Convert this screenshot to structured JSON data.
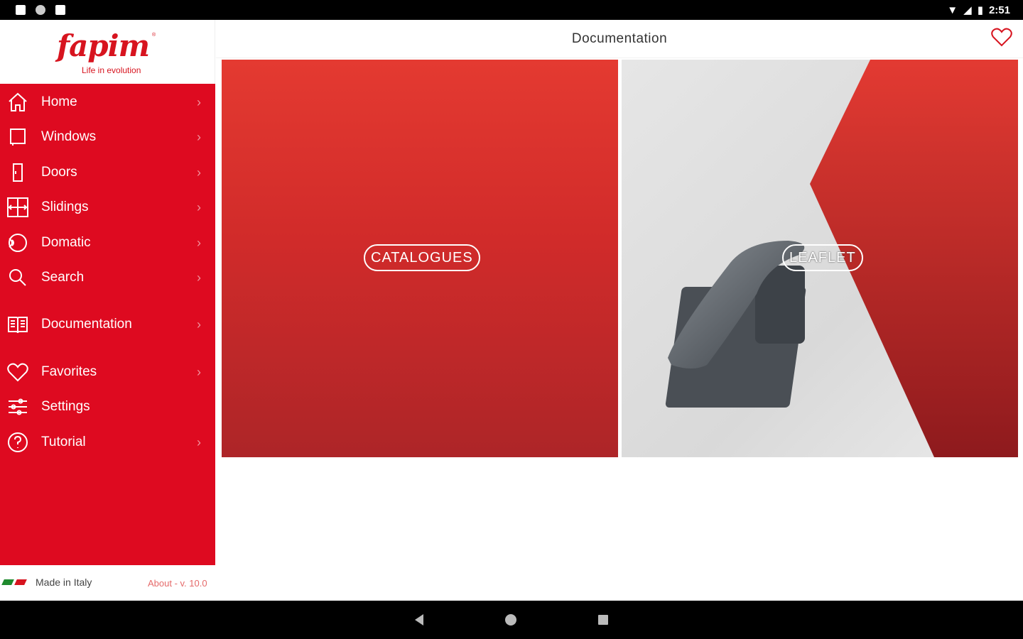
{
  "status_bar": {
    "time": "2:51"
  },
  "brand": {
    "logo": "fapim",
    "tagline": "Life in evolution"
  },
  "sidebar": {
    "items": [
      {
        "label": "Home",
        "icon": "home-icon"
      },
      {
        "label": "Windows",
        "icon": "window-icon"
      },
      {
        "label": "Doors",
        "icon": "door-icon"
      },
      {
        "label": "Slidings",
        "icon": "sliding-icon"
      },
      {
        "label": "Domatic",
        "icon": "domatic-icon"
      },
      {
        "label": "Search",
        "icon": "search-icon"
      },
      {
        "label": "Documentation",
        "icon": "book-icon"
      },
      {
        "label": "Favorites",
        "icon": "heart-icon"
      },
      {
        "label": "Settings",
        "icon": "sliders-icon"
      },
      {
        "label": "Tutorial",
        "icon": "question-icon"
      }
    ],
    "chevron": "›"
  },
  "footer": {
    "made_in": "Made in Italy",
    "about": "About - v. 10.0"
  },
  "main": {
    "title": "Documentation",
    "tiles": [
      {
        "label": "CATALOGUES"
      },
      {
        "label": "LEAFLET"
      }
    ]
  },
  "colors": {
    "brand_red": "#de0a20",
    "accent": "#d7141f"
  }
}
